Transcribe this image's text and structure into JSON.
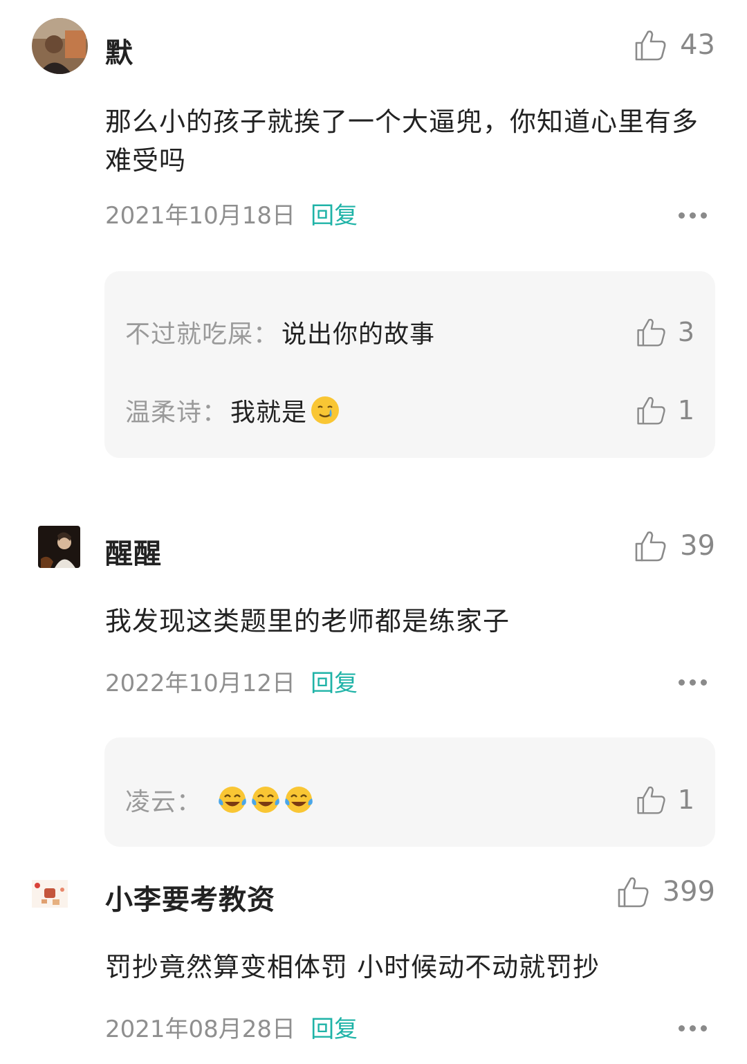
{
  "comments": [
    {
      "username": "默",
      "likes": "43",
      "text": "那么小的孩子就挨了一个大逼兜，你知道心里有多难受吗",
      "date": "2021年10月18日",
      "reply_label": "回复",
      "replies": [
        {
          "name": "不过就吃屎：",
          "text": "说出你的故事",
          "likes": "3"
        },
        {
          "name": "温柔诗：",
          "text": "我就是",
          "emoji": "crying-smile-emoji",
          "likes": "1"
        }
      ]
    },
    {
      "username": "醒醒",
      "likes": "39",
      "text": "我发现这类题里的老师都是练家子",
      "date": "2022年10月12日",
      "reply_label": "回复",
      "replies": [
        {
          "name": "凌云：",
          "text": "",
          "emoji": "tears-of-joy-emoji x3",
          "likes": "1"
        }
      ]
    },
    {
      "username": "小李要考教资",
      "likes": "399",
      "text": "罚抄竟然算变相体罚 小时候动不动就罚抄",
      "date": "2021年08月28日",
      "reply_label": "回复"
    }
  ],
  "colors": {
    "accent": "#1fb3a7",
    "muted": "#8f8f8f",
    "reply_bg": "#f6f6f6"
  }
}
